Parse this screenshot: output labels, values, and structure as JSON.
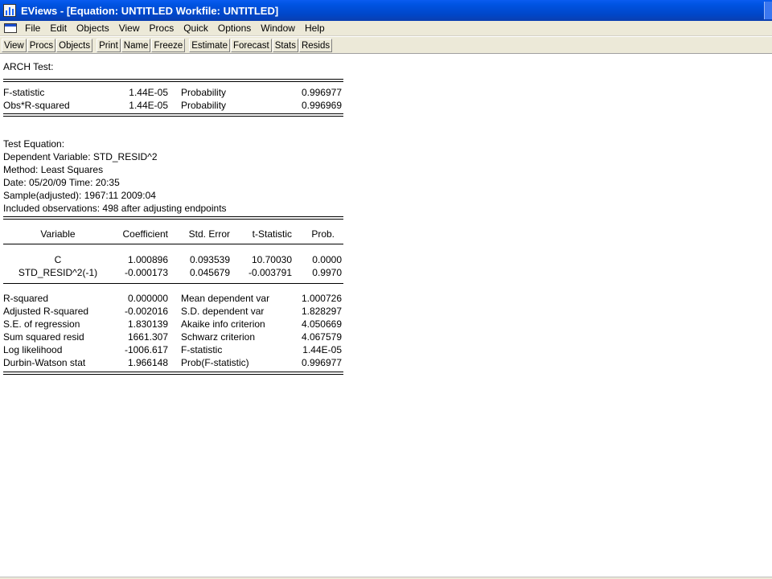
{
  "window": {
    "title": "EViews - [Equation: UNTITLED    Workfile: UNTITLED]"
  },
  "menu": [
    {
      "label": "File"
    },
    {
      "label": "Edit"
    },
    {
      "label": "Objects"
    },
    {
      "label": "View"
    },
    {
      "label": "Procs"
    },
    {
      "label": "Quick"
    },
    {
      "label": "Options"
    },
    {
      "label": "Window"
    },
    {
      "label": "Help"
    }
  ],
  "toolbar": {
    "group1": [
      "View",
      "Procs",
      "Objects"
    ],
    "group2": [
      "Print",
      "Name",
      "Freeze"
    ],
    "group3": [
      "Estimate",
      "Forecast",
      "Stats",
      "Resids"
    ]
  },
  "output": {
    "test_title": "ARCH Test:",
    "summary": [
      {
        "label": "F-statistic",
        "value": "1.44E-05",
        "plabel": "Probability",
        "pvalue": "0.996977"
      },
      {
        "label": "Obs*R-squared",
        "value": "1.44E-05",
        "plabel": "Probability",
        "pvalue": "0.996969"
      }
    ],
    "info": [
      "Test Equation:",
      "Dependent Variable: STD_RESID^2",
      "Method: Least Squares",
      "Date: 05/20/09   Time: 20:35",
      "Sample(adjusted): 1967:11 2009:04",
      "Included observations: 498 after adjusting endpoints"
    ],
    "coef_headers": [
      "Variable",
      "Coefficient",
      "Std. Error",
      "t-Statistic",
      "Prob."
    ],
    "coef_rows": [
      [
        "C",
        "1.000896",
        "0.093539",
        "10.70030",
        "0.0000"
      ],
      [
        "STD_RESID^2(-1)",
        "-0.000173",
        "0.045679",
        "-0.003791",
        "0.9970"
      ]
    ],
    "stats": [
      [
        "R-squared",
        "0.000000",
        "Mean dependent var",
        "1.000726"
      ],
      [
        "Adjusted R-squared",
        "-0.002016",
        "S.D. dependent var",
        "1.828297"
      ],
      [
        "S.E. of regression",
        "1.830139",
        "Akaike info criterion",
        "4.050669"
      ],
      [
        "Sum squared resid",
        "1661.307",
        "Schwarz criterion",
        "4.067579"
      ],
      [
        "Log likelihood",
        "-1006.617",
        "F-statistic",
        "1.44E-05"
      ],
      [
        "Durbin-Watson stat",
        "1.966148",
        "Prob(F-statistic)",
        "0.996977"
      ]
    ]
  }
}
